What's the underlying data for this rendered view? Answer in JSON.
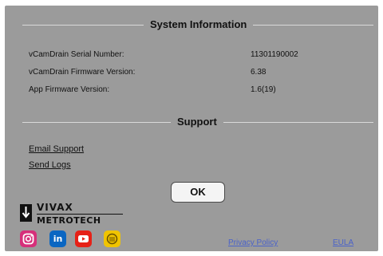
{
  "system_info": {
    "title": "System Information",
    "rows": [
      {
        "label": "vCamDrain Serial Number:",
        "value": "11301190002"
      },
      {
        "label": "vCamDrain Firmware Version:",
        "value": "6.38"
      },
      {
        "label": "App Firmware Version:",
        "value": "1.6(19)"
      }
    ]
  },
  "support": {
    "title": "Support",
    "links": [
      "Email Support",
      "Send Logs"
    ]
  },
  "ok_label": "OK",
  "brand": {
    "line1": "VIVAX",
    "line2": "METROTECH"
  },
  "social_icons": [
    "instagram-icon",
    "linkedin-icon",
    "youtube-icon",
    "vivax-app-icon"
  ],
  "footer": {
    "privacy": "Privacy Policy",
    "eula": "EULA"
  },
  "colors": {
    "panel": "#9b9b9b",
    "instagram": "#d62f7a",
    "linkedin": "#0a66c2",
    "youtube": "#e62117",
    "app": "#f0c400",
    "footer_link": "#4a62c9"
  }
}
